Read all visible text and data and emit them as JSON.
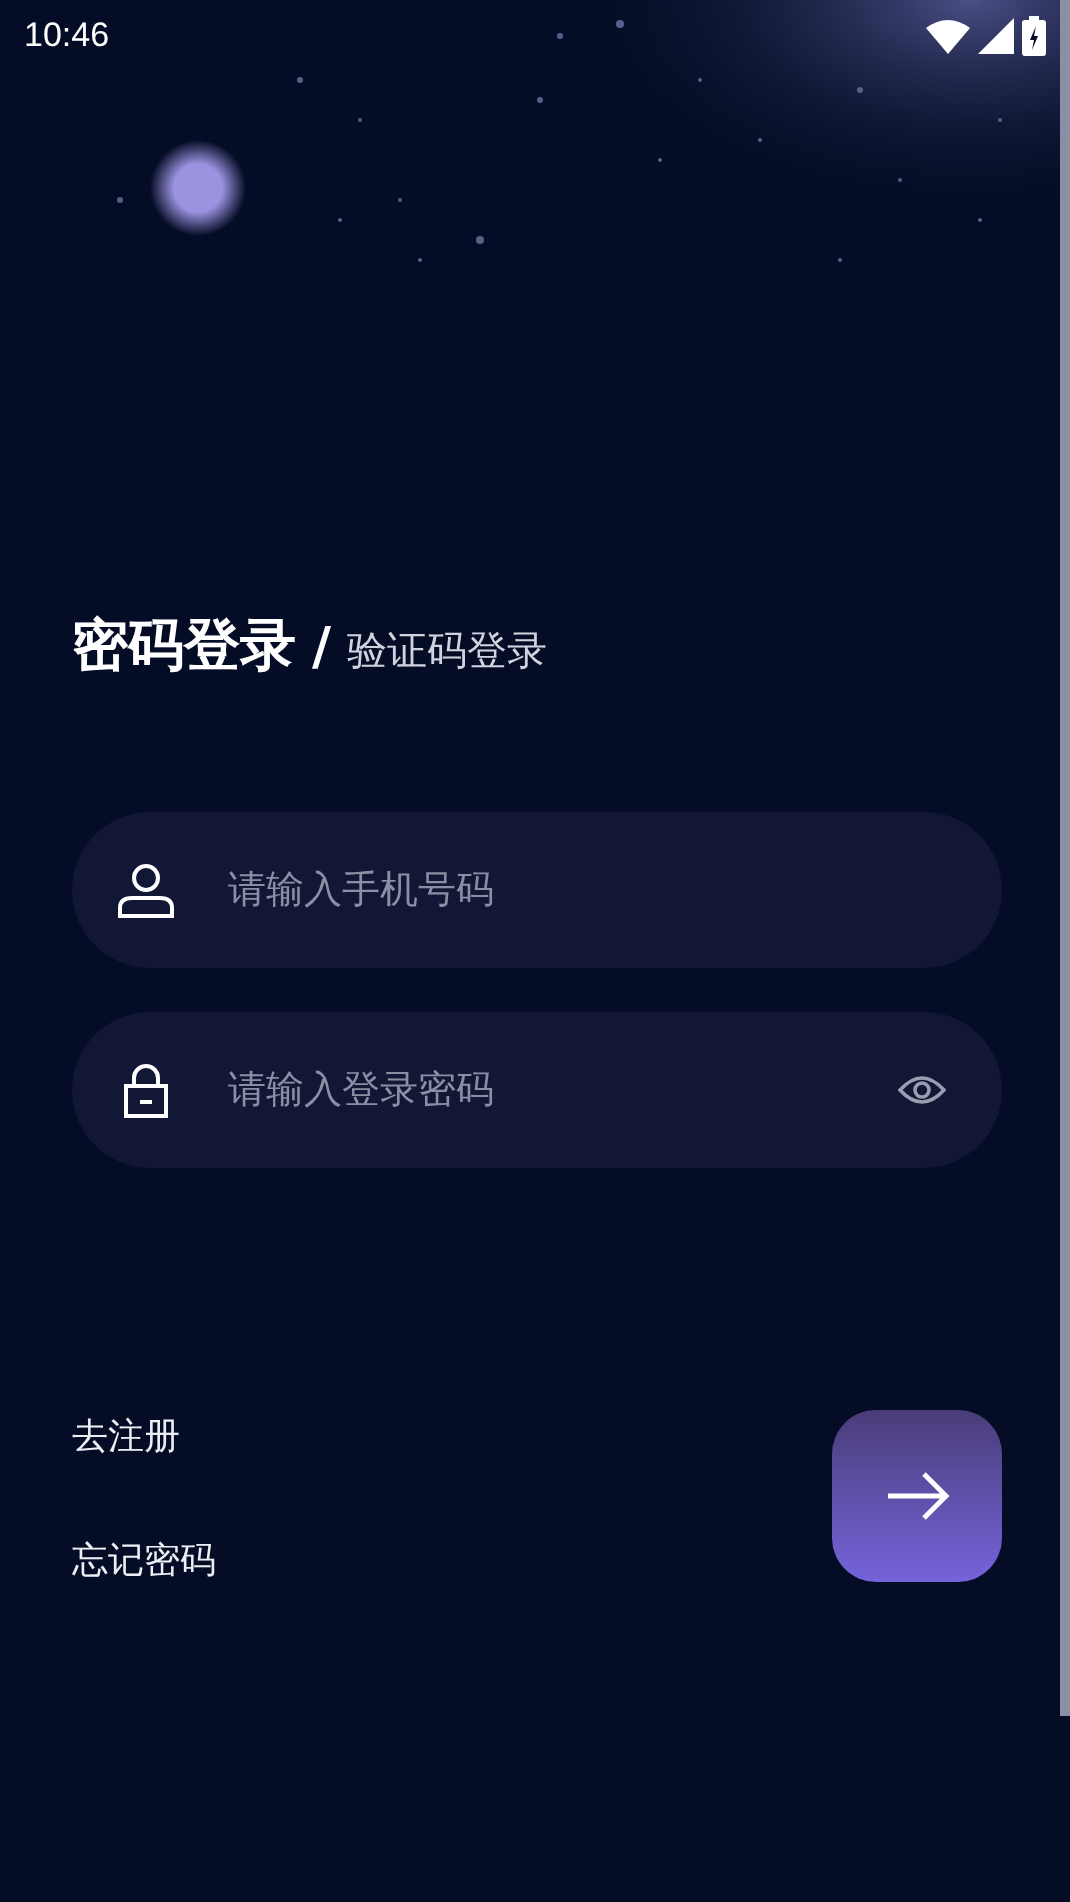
{
  "status_bar": {
    "time": "10:46"
  },
  "tabs": [
    {
      "label": "密码登录",
      "selected": true
    },
    {
      "label": "验证码登录",
      "selected": false
    }
  ],
  "separator": "/",
  "fields": [
    {
      "kind": "phone",
      "placeholder": "请输入手机号码"
    },
    {
      "kind": "password",
      "placeholder": "请输入登录密码"
    }
  ],
  "links": [
    "去注册",
    "忘记密码"
  ]
}
